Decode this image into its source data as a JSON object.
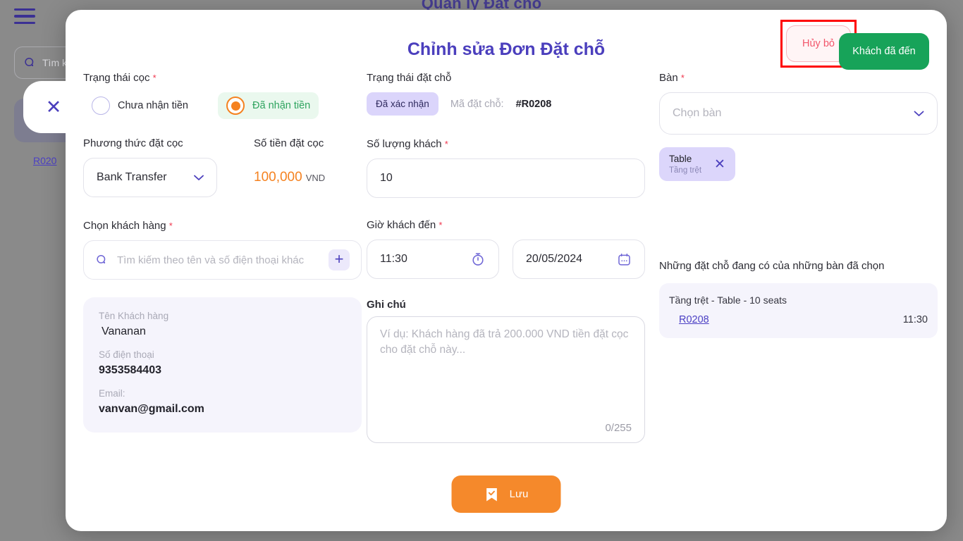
{
  "background": {
    "page_title": "Quản lý Đặt chỗ",
    "menu_icon": "hamburger-icon",
    "search_placeholder": "Tìm k",
    "reservation_link": "R020"
  },
  "modal": {
    "title": "Chỉnh sửa Đơn Đặt chỗ",
    "close_label": "✕",
    "cancel_label": "Hủy bỏ",
    "arrived_label": "Khách đã đến",
    "highlight_color": "#ff0000",
    "accent_color": "#4b3fbd",
    "success_color": "#17a359",
    "save_color": "#f5892b"
  },
  "deposit_status": {
    "label": "Trạng thái cọc",
    "required": "*",
    "options": [
      {
        "label": "Chưa nhận tiền",
        "selected": false
      },
      {
        "label": "Đã nhận tiền",
        "selected": true
      }
    ]
  },
  "deposit_method": {
    "label": "Phương thức đặt cọc",
    "value": "Bank Transfer"
  },
  "deposit_amount": {
    "label": "Số tiền đặt cọc",
    "value": "100,000",
    "currency": "VND"
  },
  "customer_select": {
    "label": "Chọn khách hàng",
    "required": "*",
    "placeholder": "Tìm kiếm theo tên và số điện thoại khác",
    "add_label": "+"
  },
  "customer_info": {
    "name_label": "Tên Khách hàng",
    "name_value": "Vananan",
    "phone_label": "Số điện thoại",
    "phone_value": "9353584403",
    "email_label": "Email:",
    "email_value": "vanvan@gmail.com"
  },
  "booking_status": {
    "label": "Trạng thái đặt chỗ",
    "badge": "Đã xác nhận",
    "code_label": "Mã đặt chỗ:",
    "code_value": "#R0208"
  },
  "guest_count": {
    "label": "Số lượng khách",
    "required": "*",
    "value": "10"
  },
  "arrival": {
    "label": "Giờ khách đến",
    "required": "*",
    "time_value": "11:30",
    "date_value": "20/05/2024"
  },
  "note": {
    "label": "Ghi chú",
    "placeholder": "Ví dụ: Khách hàng đã trả 200.000 VND tiền đặt cọc cho đặt chỗ này...",
    "counter": "0/255"
  },
  "table_select": {
    "label": "Bàn",
    "required": "*",
    "placeholder": "Chọn bàn",
    "chips": [
      {
        "name": "Table",
        "area": "Tầng trệt",
        "remove": "✕"
      }
    ]
  },
  "existing_reservations": {
    "heading": "Những đặt chỗ đang có của những bàn đã chọn",
    "items": [
      {
        "title": "Tầng trệt - Table  - 10 seats",
        "code": "R0208",
        "time": "11:30"
      }
    ]
  },
  "save": {
    "label": "Lưu",
    "icon": "bookmark-check-icon"
  }
}
